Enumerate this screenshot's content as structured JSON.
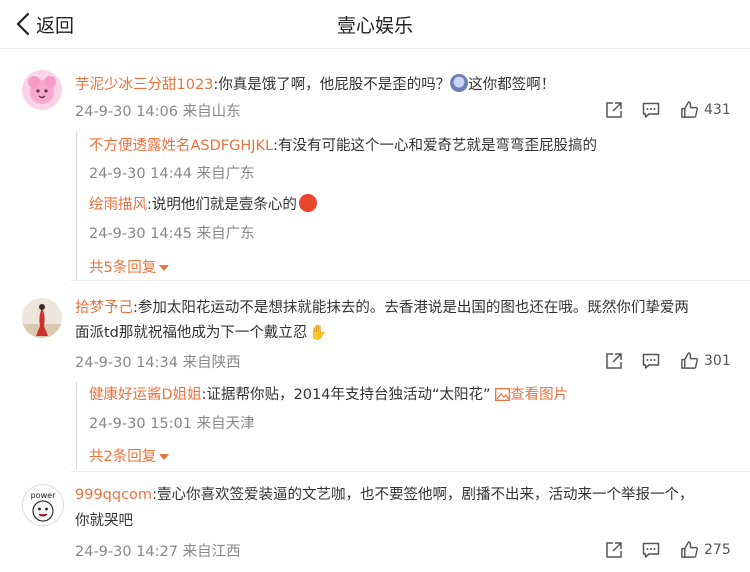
{
  "header": {
    "back_label": "返回",
    "title": "壹心娱乐"
  },
  "comments": [
    {
      "username": "芋泥少冰三分甜1023",
      "text": ":你真是饿了啊，他屁股不是歪的吗？",
      "text_after_emoji": "这你都签啊！",
      "time": "24-9-30 14:06",
      "location": "来自山东",
      "likes": "431",
      "replies": [
        {
          "username": "不方便透露姓名ASDFGHJKL",
          "text": ":有没有可能这个一心和爱奇艺就是弯弯歪屁股搞的",
          "time": "24-9-30 14:44",
          "location": "来自广东"
        },
        {
          "username": "绘雨描风",
          "text": ":说明他们就是壹条心的",
          "time": "24-9-30 14:45",
          "location": "来自广东"
        }
      ],
      "replies_more": "共5条回复"
    },
    {
      "username": "拾梦予己",
      "text": ":参加太阳花运动不是想抹就能抹去的。去香港说是出国的图也还在哦。既然你们挚爱两",
      "text_line2": "面派td那就祝福他成为下一个戴立忍",
      "time": "24-9-30 14:34",
      "location": "来自陕西",
      "likes": "301",
      "replies": [
        {
          "username": "健康好运酱D姐姐",
          "text": ":证据帮你贴，2014年支持台独活动“太阳花”",
          "link": "查看图片",
          "time": "24-9-30 15:01",
          "location": "来自天津"
        }
      ],
      "replies_more": "共2条回复"
    },
    {
      "username": "999qqcom",
      "text": ":壹心你喜欢签爱装逼的文艺咖，也不要签他啊，剧播不出来，活动来一个举报一个，",
      "text_line2": "你就哭吧",
      "time": "24-9-30 14:27",
      "location": "来自江西",
      "likes": "275",
      "avatar_text": "power"
    }
  ],
  "colors": {
    "accent": "#e8733f",
    "meta": "#888888",
    "text": "#333333"
  },
  "icons": [
    "chevron-left-icon",
    "share-icon",
    "comment-icon",
    "like-icon",
    "image-icon",
    "emoji-icon"
  ]
}
